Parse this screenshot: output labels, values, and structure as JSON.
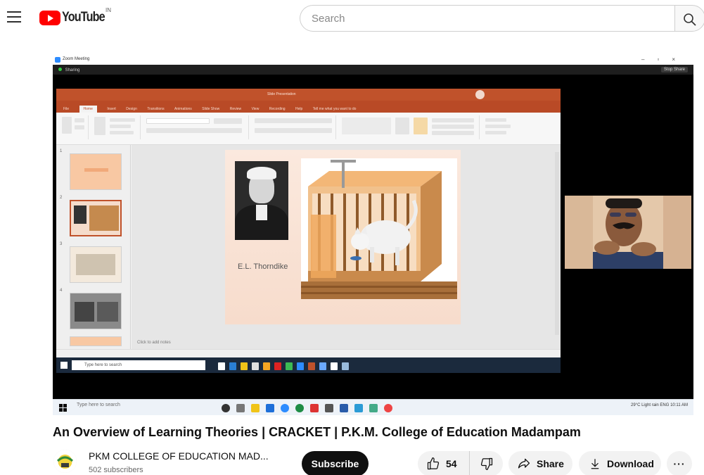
{
  "header": {
    "logo_text": "YouTube",
    "region_code": "IN",
    "search_placeholder": "Search"
  },
  "video": {
    "zoom_window_title": "Zoom Meeting",
    "zoom_share_label": "Sharing",
    "zoom_share_button": "Stop Share",
    "ppt_title": "Slide Presentation",
    "ppt_tabs": [
      "File",
      "Home",
      "Insert",
      "Design",
      "Transitions",
      "Animations",
      "Slide Show",
      "Review",
      "View",
      "Recording",
      "Help",
      "Tell me what you want to do"
    ],
    "slide_caption": "E.L. Thorndike",
    "notes_placeholder": "Click to add notes",
    "remote_search_placeholder": "Type here to search",
    "outer_search_placeholder": "Type here to search",
    "outer_tray_text": "29°C Light rain   ENG   10:11 AM"
  },
  "title": "An Overview of Learning Theories | CRACKET | P.K.M. College of Education Madampam",
  "channel": {
    "name": "PKM COLLEGE OF EDUCATION MAD...",
    "subscribers": "502 subscribers"
  },
  "actions": {
    "subscribe": "Subscribe",
    "like_count": "54",
    "share": "Share",
    "download": "Download",
    "more": "···"
  },
  "icons": {
    "menu": "hamburger-icon",
    "search": "magnifier-icon",
    "like": "thumbs-up-icon",
    "dislike": "thumbs-down-icon",
    "share": "share-arrow-icon",
    "download": "download-arrow-icon"
  },
  "colors": {
    "youtube_red": "#ff0000",
    "ppt_orange": "#c0522b",
    "subscribe_bg": "#0f0f0f"
  }
}
